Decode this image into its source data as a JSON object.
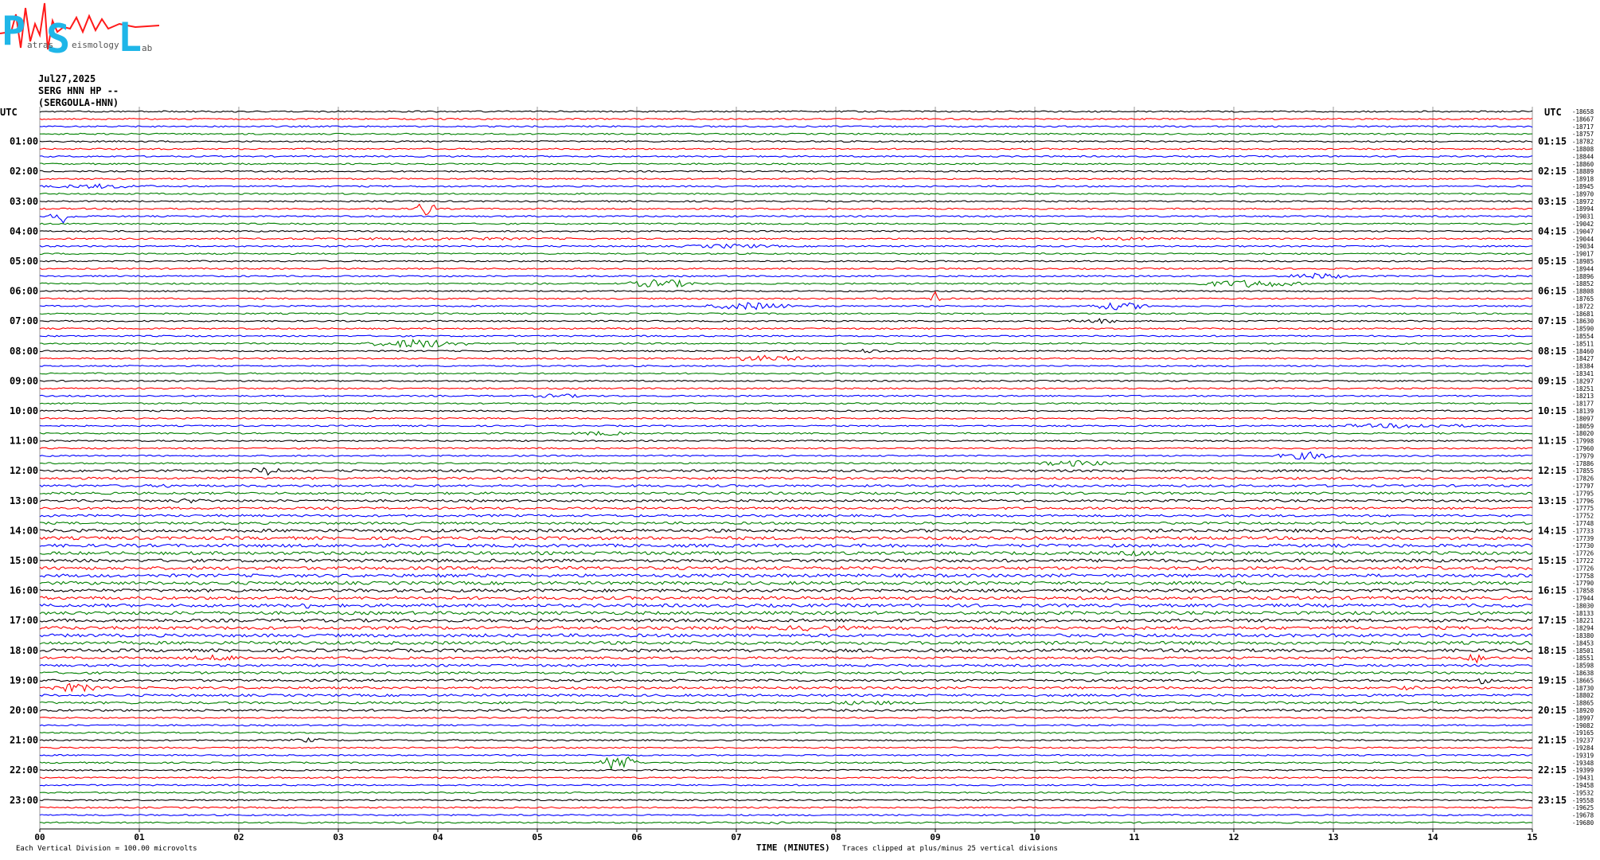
{
  "logo": {
    "letters": [
      "P",
      "S",
      "L"
    ],
    "words": [
      "atras",
      "eismology",
      "ab"
    ],
    "colors": {
      "letters": "#1fb6e8",
      "trace": "#ff1a1a",
      "words": "#555555"
    }
  },
  "header": {
    "date": "Jul27,2025",
    "station": "SERG HNN HP --",
    "site": "(SERGOULA-HNN)"
  },
  "labels": {
    "utc_left": "UTC",
    "utc_right": "UTC",
    "xlabel": "TIME (MINUTES)",
    "footer_left": "Each Vertical Division =  100.00 microvolts",
    "footer_right": "Traces clipped at plus/minus 25 vertical divisions"
  },
  "chart_data": {
    "type": "line",
    "trace_colors": [
      "#000000",
      "#ff0000",
      "#0000ff",
      "#008000"
    ],
    "trace_count": 96,
    "minutes_per_trace": 15,
    "x_ticks": [
      "00",
      "01",
      "02",
      "03",
      "04",
      "05",
      "06",
      "07",
      "08",
      "09",
      "10",
      "11",
      "12",
      "13",
      "14",
      "15"
    ],
    "xlim": [
      0,
      15
    ],
    "left_hour_labels": [
      "01:00",
      "02:00",
      "03:00",
      "04:00",
      "05:00",
      "06:00",
      "07:00",
      "08:00",
      "09:00",
      "10:00",
      "11:00",
      "12:00",
      "13:00",
      "14:00",
      "15:00",
      "16:00",
      "17:00",
      "18:00",
      "19:00",
      "20:00",
      "21:00",
      "22:00",
      "23:00"
    ],
    "right_hour_labels": [
      "01:15",
      "02:15",
      "03:15",
      "04:15",
      "05:15",
      "06:15",
      "07:15",
      "08:15",
      "09:15",
      "10:15",
      "11:15",
      "12:15",
      "13:15",
      "14:15",
      "15:15",
      "16:15",
      "17:15",
      "18:15",
      "19:15",
      "20:15",
      "21:15",
      "22:15",
      "23:15"
    ],
    "trace_values": [
      -18658,
      -18667,
      -18717,
      -18757,
      -18782,
      -18808,
      -18844,
      -18860,
      -18889,
      -18918,
      -18945,
      -18970,
      -18972,
      -18994,
      -19031,
      -19042,
      -19047,
      -19044,
      -19034,
      -19017,
      -18985,
      -18944,
      -18896,
      -18852,
      -18808,
      -18765,
      -18722,
      -18681,
      -18630,
      -18590,
      -18554,
      -18511,
      -18460,
      -18427,
      -18384,
      -18341,
      -18297,
      -18251,
      -18213,
      -18177,
      -18139,
      -18097,
      -18059,
      -18020,
      -17998,
      -17960,
      -17979,
      -17886,
      -17855,
      -17826,
      -17797,
      -17795,
      -17796,
      -17775,
      -17752,
      -17748,
      -17733,
      -17739,
      -17730,
      -17726,
      -17722,
      -17726,
      -17758,
      -17790,
      -17858,
      -17944,
      -18030,
      -18133,
      -18221,
      -18294,
      -18380,
      -18453,
      -18501,
      -18551,
      -18598,
      -18638,
      -18665,
      -18730,
      -18802,
      -18865,
      -18920,
      -18997,
      -19082,
      -19165,
      -19237,
      -19284,
      -19319,
      -19348,
      -19399,
      -19431,
      -19458,
      -19532,
      -19558,
      -19625,
      -19678,
      -19680
    ],
    "events": [
      {
        "trace": 10,
        "minute_start": 0.0,
        "minute_end": 1.2,
        "amp": 3
      },
      {
        "trace": 13,
        "minute_start": 3.75,
        "minute_end": 4.0,
        "amp": 10
      },
      {
        "trace": 14,
        "minute_start": 0.1,
        "minute_end": 0.35,
        "amp": 9
      },
      {
        "trace": 17,
        "minute_start": 2.0,
        "minute_end": 6.0,
        "amp": 2
      },
      {
        "trace": 17,
        "minute_start": 10.0,
        "minute_end": 11.8,
        "amp": 2
      },
      {
        "trace": 18,
        "minute_start": 6.4,
        "minute_end": 7.5,
        "amp": 3
      },
      {
        "trace": 22,
        "minute_start": 12.5,
        "minute_end": 13.2,
        "amp": 4
      },
      {
        "trace": 23,
        "minute_start": 5.9,
        "minute_end": 6.6,
        "amp": 6
      },
      {
        "trace": 23,
        "minute_start": 11.6,
        "minute_end": 12.7,
        "amp": 5
      },
      {
        "trace": 25,
        "minute_start": 8.95,
        "minute_end": 9.05,
        "amp": 10
      },
      {
        "trace": 26,
        "minute_start": 6.7,
        "minute_end": 7.6,
        "amp": 5
      },
      {
        "trace": 26,
        "minute_start": 10.5,
        "minute_end": 11.2,
        "amp": 5
      },
      {
        "trace": 28,
        "minute_start": 10.3,
        "minute_end": 11.0,
        "amp": 3
      },
      {
        "trace": 31,
        "minute_start": 3.3,
        "minute_end": 4.3,
        "amp": 6
      },
      {
        "trace": 32,
        "minute_start": 8.1,
        "minute_end": 8.5,
        "amp": 3
      },
      {
        "trace": 33,
        "minute_start": 6.8,
        "minute_end": 7.8,
        "amp": 4
      },
      {
        "trace": 38,
        "minute_start": 4.9,
        "minute_end": 5.5,
        "amp": 3
      },
      {
        "trace": 43,
        "minute_start": 5.3,
        "minute_end": 6.0,
        "amp": 3
      },
      {
        "trace": 42,
        "minute_start": 12.8,
        "minute_end": 14.6,
        "amp": 3
      },
      {
        "trace": 48,
        "minute_start": 2.1,
        "minute_end": 2.5,
        "amp": 6
      },
      {
        "trace": 47,
        "minute_start": 10.0,
        "minute_end": 10.8,
        "amp": 4
      },
      {
        "trace": 46,
        "minute_start": 12.4,
        "minute_end": 13.1,
        "amp": 5
      },
      {
        "trace": 50,
        "minute_start": 1.1,
        "minute_end": 1.4,
        "amp": 3
      },
      {
        "trace": 52,
        "minute_start": 1.2,
        "minute_end": 1.8,
        "amp": 3
      },
      {
        "trace": 56,
        "minute_start": 5.2,
        "minute_end": 5.8,
        "amp": 3
      },
      {
        "trace": 59,
        "minute_start": 10.8,
        "minute_end": 11.3,
        "amp": 4
      },
      {
        "trace": 66,
        "minute_start": 2.5,
        "minute_end": 2.9,
        "amp": 4
      },
      {
        "trace": 69,
        "minute_start": 7.2,
        "minute_end": 8.4,
        "amp": 4
      },
      {
        "trace": 73,
        "minute_start": 1.4,
        "minute_end": 2.2,
        "amp": 4
      },
      {
        "trace": 73,
        "minute_start": 14.3,
        "minute_end": 14.6,
        "amp": 6
      },
      {
        "trace": 76,
        "minute_start": 14.4,
        "minute_end": 14.6,
        "amp": 5
      },
      {
        "trace": 77,
        "minute_start": 0.1,
        "minute_end": 0.6,
        "amp": 6
      },
      {
        "trace": 77,
        "minute_start": 13.6,
        "minute_end": 13.9,
        "amp": 3
      },
      {
        "trace": 79,
        "minute_start": 7.8,
        "minute_end": 8.8,
        "amp": 3
      },
      {
        "trace": 84,
        "minute_start": 2.5,
        "minute_end": 2.9,
        "amp": 3
      },
      {
        "trace": 87,
        "minute_start": 5.6,
        "minute_end": 6.0,
        "amp": 12
      },
      {
        "trace": 95,
        "minute_start": 7.3,
        "minute_end": 7.5,
        "amp": 3
      }
    ]
  }
}
